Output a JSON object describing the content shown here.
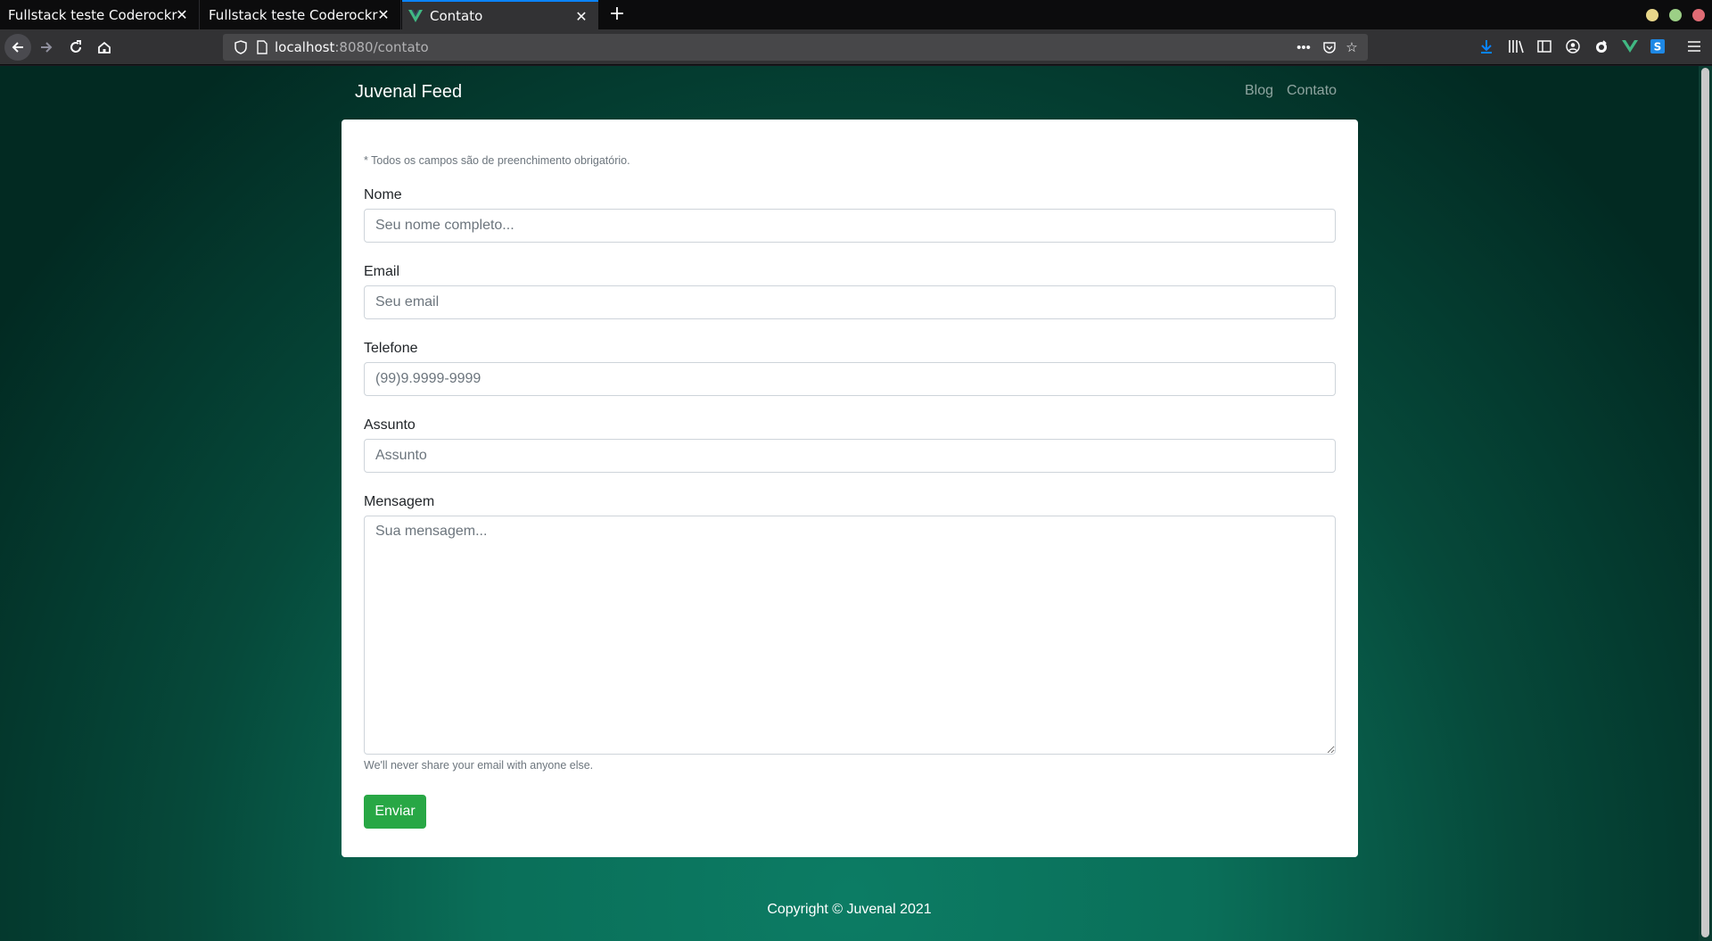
{
  "browser": {
    "tabs": [
      {
        "title": "Fullstack teste Coderockr",
        "active": false
      },
      {
        "title": "Fullstack teste Coderockr",
        "active": false
      },
      {
        "title": "Contato",
        "active": true
      }
    ],
    "url": {
      "host": "localhost",
      "rest": ":8080/contato"
    },
    "colors": {
      "active_tab_accent": "#0a84ff",
      "favicon_green": "#41b883"
    }
  },
  "site": {
    "brand": "Juvenal Feed",
    "nav": [
      {
        "label": "Blog"
      },
      {
        "label": "Contato"
      }
    ]
  },
  "form": {
    "required_note": "* Todos os campos são de preenchimento obrigatório.",
    "fields": [
      {
        "label": "Nome",
        "placeholder": "Seu nome completo..."
      },
      {
        "label": "Email",
        "placeholder": "Seu email"
      },
      {
        "label": "Telefone",
        "placeholder": "(99)9.9999-9999"
      },
      {
        "label": "Assunto",
        "placeholder": "Assunto"
      },
      {
        "label": "Mensagem",
        "placeholder": "Sua mensagem..."
      }
    ],
    "help_text": "We'll never share your email with anyone else.",
    "submit_label": "Enviar",
    "submit_color": "#28a745"
  },
  "footer": {
    "text": "Copyright © Juvenal 2021"
  },
  "theme": {
    "gradient_center": "#0c7c64",
    "gradient_edge": "#022a22"
  }
}
